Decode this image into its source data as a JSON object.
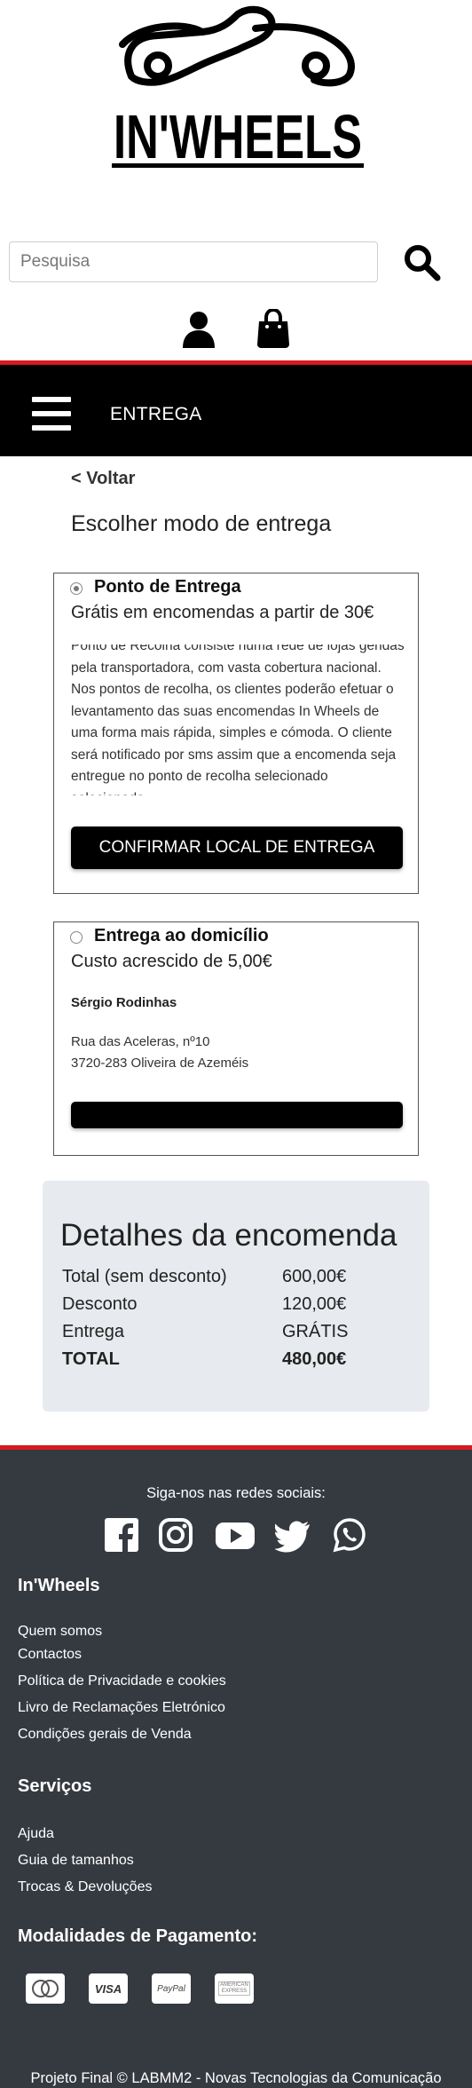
{
  "brand": {
    "logo_text": "IN'WHEELS"
  },
  "search": {
    "placeholder": "Pesquisa"
  },
  "icons": {
    "search": "search-icon",
    "user": "user-icon",
    "bag": "shopping-bag-icon",
    "menu": "hamburger-icon"
  },
  "topbar": {
    "title": "ENTREGA"
  },
  "nav": {
    "back": "< Voltar"
  },
  "page": {
    "title": "Escolher modo de entrega"
  },
  "options": {
    "pickup": {
      "label": "Ponto de Entrega",
      "selected": true,
      "subtitle": "Grátis em encomendas a partir de 30€",
      "description": "Ponto de Recolha consiste numa rede de lojas geridas pela transportadora, com vasta cobertura nacional. Nos pontos de recolha, os clientes poderão efetuar o levantamento das suas encomendas In Wheels de uma forma mais rápida, simples e cómoda. O cliente será notificado por sms assim que a encomenda seja entregue no ponto de recolha selecionado selecionado.",
      "button": "CONFIRMAR LOCAL DE ENTREGA"
    },
    "home": {
      "label": "Entrega ao domicílio",
      "selected": false,
      "subtitle": "Custo acrescido de 5,00€",
      "name": "Sérgio Rodinhas",
      "address_line1": "Rua das Aceleras, nº10",
      "address_line2": "3720-283 Oliveira de Azeméis"
    }
  },
  "summary": {
    "title": "Detalhes da encomenda",
    "rows": [
      {
        "label": "Total (sem desconto)",
        "value": "600,00€"
      },
      {
        "label": "Desconto",
        "value": "120,00€"
      },
      {
        "label": "Entrega",
        "value": "GRÁTIS"
      },
      {
        "label": "TOTAL",
        "value": "480,00€"
      }
    ]
  },
  "footer": {
    "follow": "Siga-nos nas redes sociais:",
    "social": [
      "facebook-icon",
      "instagram-icon",
      "youtube-icon",
      "twitter-icon",
      "whatsapp-icon"
    ],
    "brand_heading": "In'Wheels",
    "brand_links": [
      "Quem somos",
      "Contactos",
      "Política de Privacidade e cookies",
      "Livro de Reclamações Eletrónico",
      "Condições gerais de Venda"
    ],
    "services_heading": "Serviços",
    "services_links": [
      "Ajuda",
      "Guia de tamanhos",
      "Trocas & Devoluções"
    ],
    "payment_heading": "Modalidades de Pagamento:",
    "payment_methods": [
      "VISA",
      "PayPal",
      "AMERICAN EXPRESS"
    ],
    "copyright": "Projeto Final © LABMM2 - Novas Tecnologias da Comunicação"
  },
  "colors": {
    "accent_red": "#d71920",
    "dark_bar": "#000000",
    "footer_bg": "#353a41",
    "summary_bg": "#e7eaee"
  }
}
